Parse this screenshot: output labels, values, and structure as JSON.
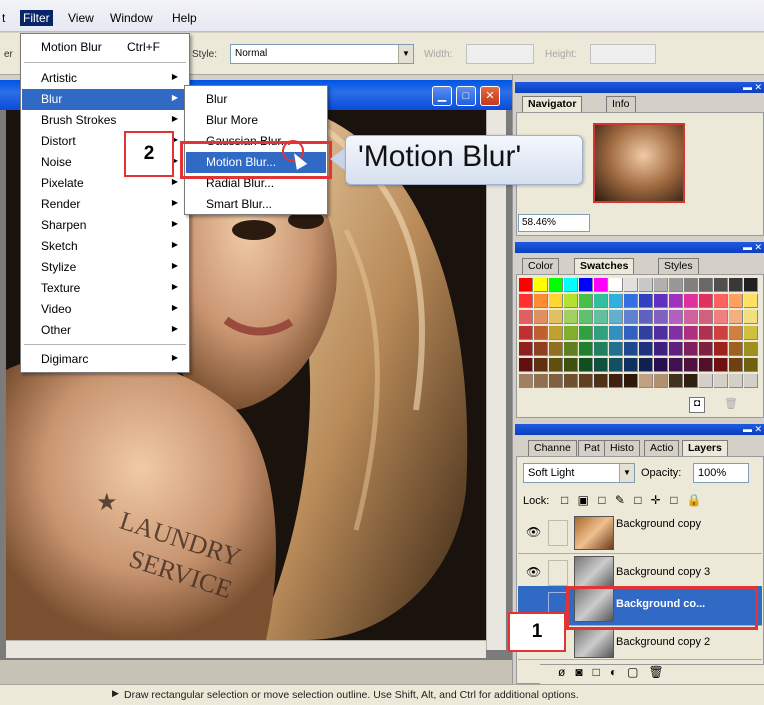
{
  "menubar": {
    "items": [
      {
        "label": "t"
      },
      {
        "label": "Filter"
      },
      {
        "label": "View"
      },
      {
        "label": "Window"
      },
      {
        "label": "Help"
      }
    ]
  },
  "options": {
    "style_label": "Style:",
    "style_value": "Normal",
    "width_label": "Width:",
    "height_label": "Height:",
    "left_partial": "er"
  },
  "filter_menu": {
    "items": [
      {
        "label": "Motion Blur",
        "shortcut": "Ctrl+F"
      },
      {
        "label": "Artistic"
      },
      {
        "label": "Blur"
      },
      {
        "label": "Brush Strokes"
      },
      {
        "label": "Distort"
      },
      {
        "label": "Noise"
      },
      {
        "label": "Pixelate"
      },
      {
        "label": "Render"
      },
      {
        "label": "Sharpen"
      },
      {
        "label": "Sketch"
      },
      {
        "label": "Stylize"
      },
      {
        "label": "Texture"
      },
      {
        "label": "Video"
      },
      {
        "label": "Other"
      },
      {
        "label": "Digimarc"
      }
    ]
  },
  "blur_menu": {
    "items": [
      {
        "label": "Blur"
      },
      {
        "label": "Blur More"
      },
      {
        "label": "Gaussian Blur..."
      },
      {
        "label": "Motion Blur..."
      },
      {
        "label": "Radial Blur..."
      },
      {
        "label": "Smart Blur..."
      }
    ]
  },
  "annotations": {
    "callout": "'Motion Blur'",
    "step1": "1",
    "step2": "2"
  },
  "navigator": {
    "tabs": [
      "Navigator",
      "Info"
    ],
    "zoom": "58.46%"
  },
  "swatches": {
    "tabs": [
      "Color",
      "Swatches",
      "Styles"
    ],
    "colors": [
      "#ff0000",
      "#ffff00",
      "#00ff00",
      "#00ffff",
      "#0000ff",
      "#ff00ff",
      "#ffffff",
      "#e0e0e0",
      "#c8c8c8",
      "#b0b0b0",
      "#989898",
      "#808080",
      "#686868",
      "#505050",
      "#383838",
      "#202020",
      "#ff3030",
      "#ff8c30",
      "#ffd730",
      "#b4e030",
      "#48c048",
      "#30c0a0",
      "#30b0e0",
      "#3070e0",
      "#3040c0",
      "#6030c0",
      "#a030c0",
      "#e030a0",
      "#e03060",
      "#ff6060",
      "#ffa060",
      "#ffe060",
      "#e06060",
      "#e09060",
      "#e0c060",
      "#a0d060",
      "#60c070",
      "#60c0a0",
      "#60b0d0",
      "#6080d0",
      "#6060c0",
      "#8060c0",
      "#b060c0",
      "#d060a0",
      "#d06080",
      "#f08080",
      "#f0b080",
      "#f0e080",
      "#c03030",
      "#c06030",
      "#c0a030",
      "#80b030",
      "#30a040",
      "#30a080",
      "#3090c0",
      "#3060c0",
      "#3040a0",
      "#5030a0",
      "#8030a0",
      "#b03080",
      "#b03050",
      "#d04040",
      "#d08040",
      "#d0c040",
      "#902020",
      "#904020",
      "#907020",
      "#608020",
      "#208030",
      "#208060",
      "#207090",
      "#204890",
      "#203080",
      "#402080",
      "#602080",
      "#802060",
      "#802040",
      "#a02020",
      "#a06020",
      "#a09020",
      "#601010",
      "#603010",
      "#605010",
      "#405010",
      "#105020",
      "#105040",
      "#105060",
      "#103060",
      "#102050",
      "#281050",
      "#401050",
      "#501040",
      "#501028",
      "#701010",
      "#704010",
      "#706010",
      "#a08060",
      "#907050",
      "#806040",
      "#705030",
      "#604020",
      "#503018",
      "#402010",
      "#301808",
      "#c0a080",
      "#b09070",
      "#403020",
      "#302010",
      "#d4d0c8",
      "#d4d0c8",
      "#d4d0c8",
      "#d4d0c8"
    ]
  },
  "layers_panel": {
    "tabs": [
      "Channe",
      "Pat",
      "Histo",
      "Actio",
      "Layers"
    ],
    "blend_mode": "Soft Light",
    "opacity_label": "Opacity:",
    "opacity_value": "100%",
    "lock_label": "Lock:",
    "layers": [
      {
        "name": "Background copy"
      },
      {
        "name": "Background copy 3"
      },
      {
        "name": "Background co..."
      },
      {
        "name": "Background copy 2"
      }
    ]
  },
  "status": {
    "text": "Draw rectangular selection or move selection outline. Use Shift, Alt, and Ctrl for additional options."
  }
}
